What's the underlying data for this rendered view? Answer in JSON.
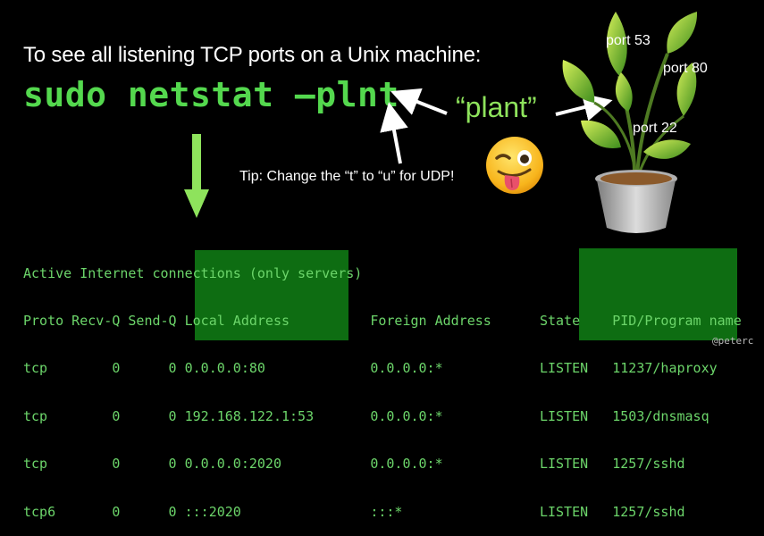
{
  "headline": "To see all listening TCP ports on a Unix machine:",
  "command": "sudo netstat –plnt",
  "mnemonic": "“plant”",
  "tip": "Tip: Change the “t” to “u” for UDP!",
  "plant_labels": [
    "port 53",
    "port 80",
    "port 22"
  ],
  "credit": "@peterc",
  "emoji": "winking-face-with-tongue",
  "terminal": {
    "title_line": "Active Internet connections (only servers)",
    "header_line": "Proto Recv-Q Send-Q Local Address          Foreign Address      State    PID/Program name",
    "rows": [
      "tcp        0      0 0.0.0.0:80             0.0.0.0:*            LISTEN   11237/haproxy",
      "tcp        0      0 192.168.122.1:53       0.0.0.0:*            LISTEN   1503/dnsmasq",
      "tcp        0      0 0.0.0.0:2020           0.0.0.0:*            LISTEN   1257/sshd",
      "tcp6       0      0 :::2020                :::*                 LISTEN   1257/sshd"
    ]
  },
  "colors": {
    "background": "#000000",
    "command_green": "#54d84e",
    "terminal_green": "#6cd56a",
    "highlight_green": "#0e6d12",
    "arrow_green": "#8ee35c"
  }
}
